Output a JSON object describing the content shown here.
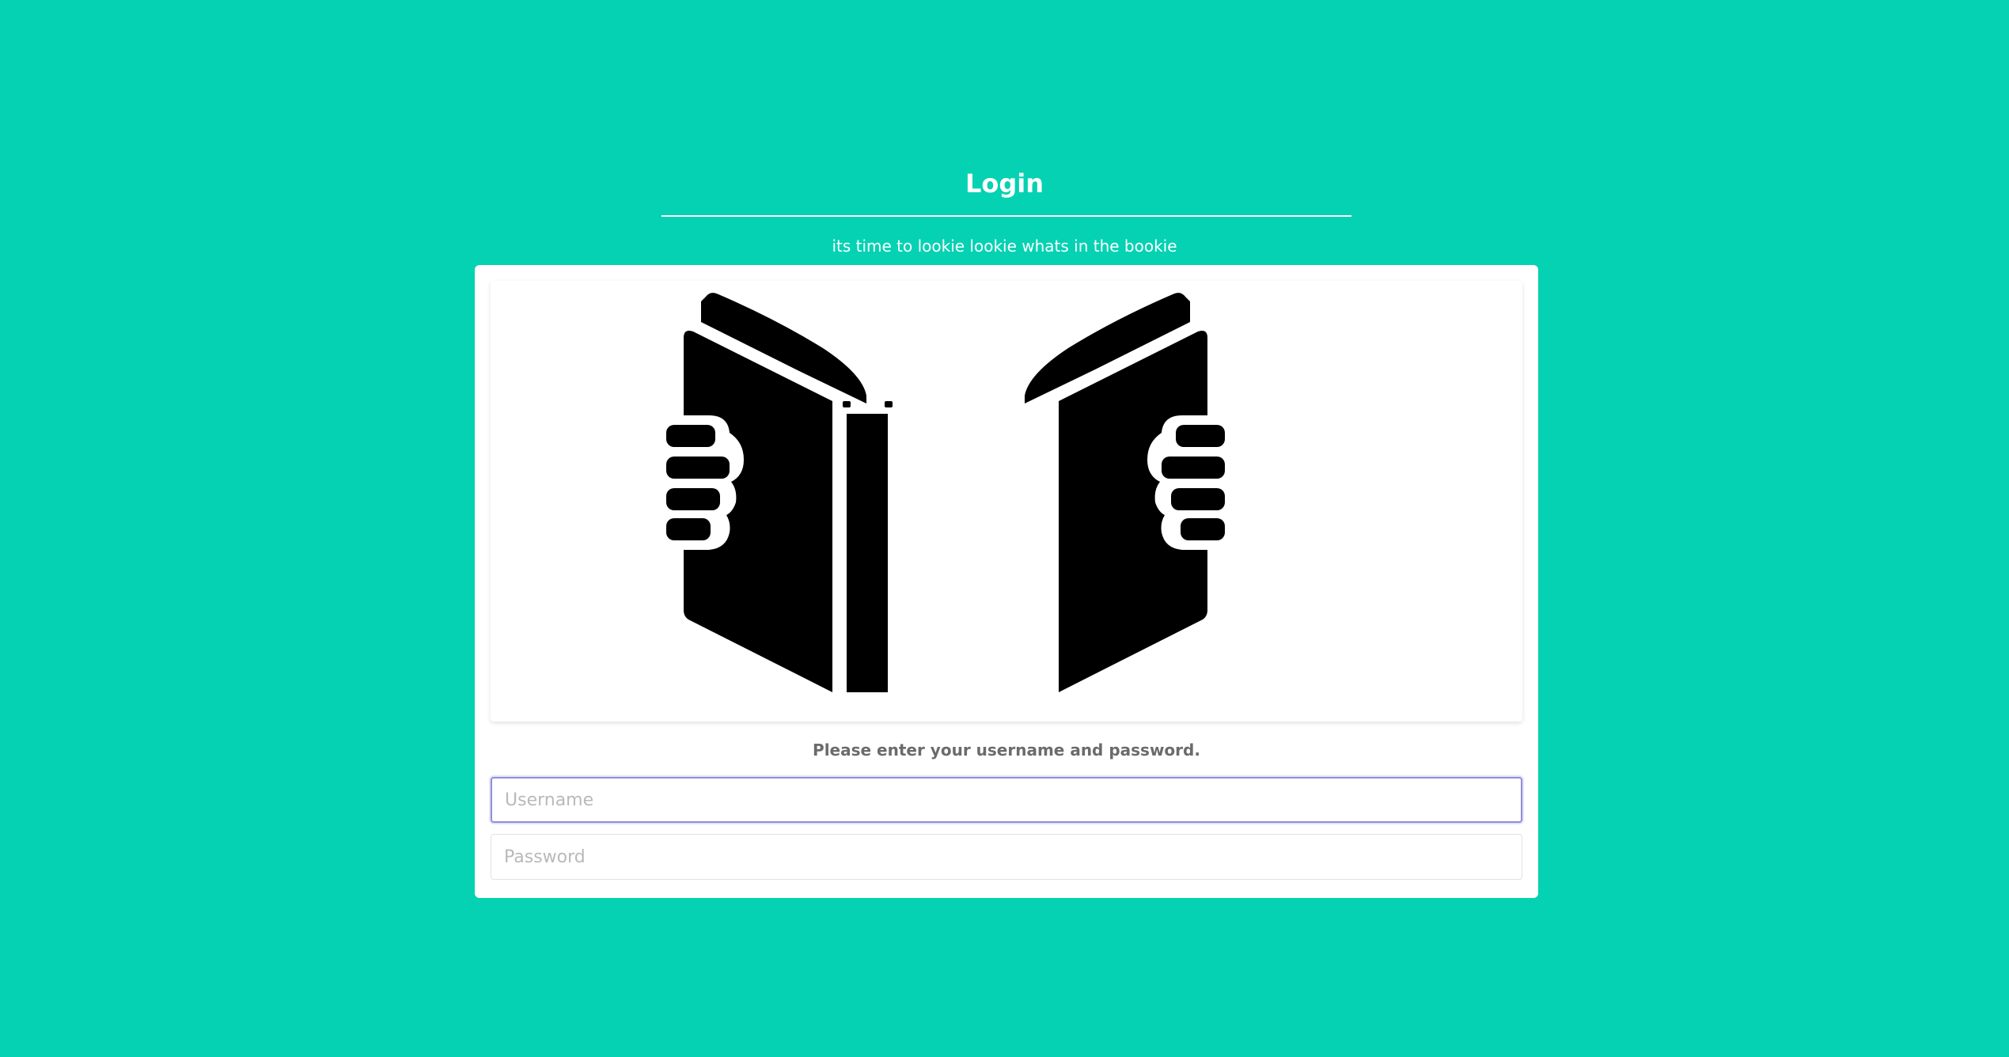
{
  "login": {
    "title": "Login",
    "subtitle": "its time to lookie lookie whats in the bookie",
    "instruction": "Please enter your username and password.",
    "username": {
      "placeholder": "Username",
      "value": ""
    },
    "password": {
      "placeholder": "Password",
      "value": ""
    }
  },
  "colors": {
    "background": "#04d2b3",
    "card": "#ffffff",
    "focus_border": "#8f8fd9",
    "instruction_text": "#6b6b6b"
  },
  "icons": {
    "illustration": "open-book-hands-icon"
  }
}
